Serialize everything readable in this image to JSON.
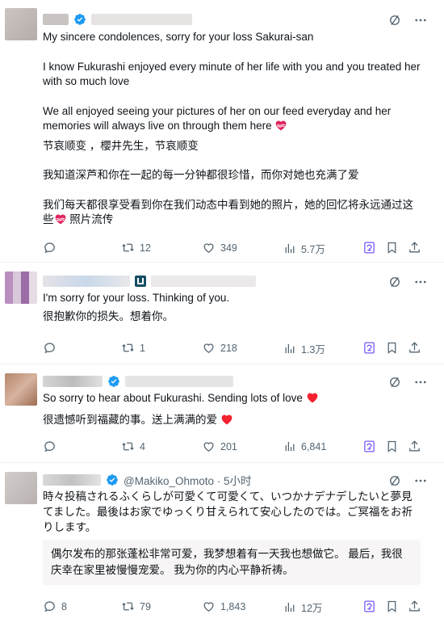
{
  "posts": [
    {
      "avatar_colors": [
        "#c8c0bc",
        "#b9b2b0"
      ],
      "lines": [
        "My sincere condolences, sorry for your loss Sakurai-san",
        "I know Fukurashi enjoyed every minute of her life with you and you treated her with so much love",
        "We all enjoyed seeing your pictures of her on our feed everyday and her memories will always live on through them here",
        "节哀顺变 ，櫻井先生，节哀顺变",
        "我知道深芦和你在一起的每一分钟都很珍惜，而你对她也充满了爱",
        "我们每天都很享受看到你在我们动态中看到她的照片，她的回忆将永远通过这些",
        "照片流传"
      ],
      "stats": {
        "replies": "",
        "reposts": "12",
        "likes": "349",
        "views": "5.7万"
      }
    },
    {
      "avatar_colors": [
        "#b98fc0",
        "#d9c6d8"
      ],
      "lines": [
        "I'm sorry for your loss. Thinking of you.",
        "很抱歉你的损失。想着你。"
      ],
      "stats": {
        "replies": "",
        "reposts": "1",
        "likes": "218",
        "views": "1.3万"
      }
    },
    {
      "avatar_colors": [
        "#b5866a",
        "#d9b7a2"
      ],
      "lines": [
        "So sorry to hear about Fukurashi. Sending lots of love",
        "很遗憾听到福藏的事。送上满满的爱"
      ],
      "stats": {
        "replies": "",
        "reposts": "4",
        "likes": "201",
        "views": "6,841"
      }
    },
    {
      "avatar_colors": [
        "#cfcac8",
        "#bdb6b4"
      ],
      "handle": "@Makiko_Ohmoto · 5小时",
      "lines": [
        "時々投稿されるふくらしが可愛くて可愛くて、いつかナデナデしたいと夢見てました。最後はお家でゆっくり甘えられて安心したのでは。ご冥福をお祈りします。"
      ],
      "translation": "偶尔发布的那张蓬松非常可爱，我梦想着有一天我也想做它。 最后，我很庆幸在家里被慢慢宠爱。 我为你的内心平静祈祷。",
      "stats": {
        "replies": "8",
        "reposts": "79",
        "likes": "1,843",
        "views": "12万"
      }
    }
  ],
  "colors": {
    "text": "#0f1419",
    "muted": "#536471",
    "verified": "#1d9bf0",
    "heart": "#f4212e",
    "highlight": "#7856ff",
    "translate_bg": "#f7f5f5"
  }
}
